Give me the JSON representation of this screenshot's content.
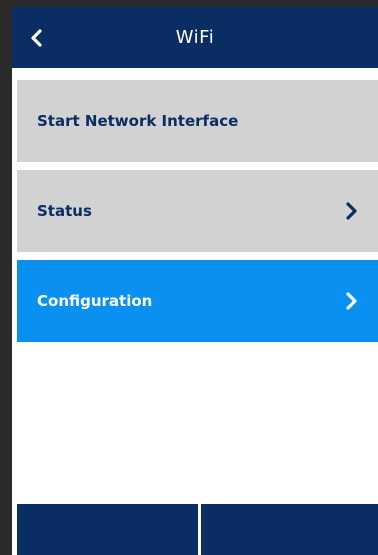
{
  "header": {
    "title": "WiFi",
    "back_icon": "chevron-left-icon"
  },
  "menu": {
    "items": [
      {
        "label": "Start Network Interface",
        "has_chevron": false,
        "state": "normal"
      },
      {
        "label": "Status",
        "has_chevron": true,
        "state": "normal"
      },
      {
        "label": "Configuration",
        "has_chevron": true,
        "state": "selected"
      }
    ]
  },
  "colors": {
    "header_bg": "#0a2e63",
    "item_bg": "#d2d2d2",
    "item_text": "#0a2e63",
    "selected_bg": "#0a90f0",
    "selected_text": "#ffffff"
  }
}
